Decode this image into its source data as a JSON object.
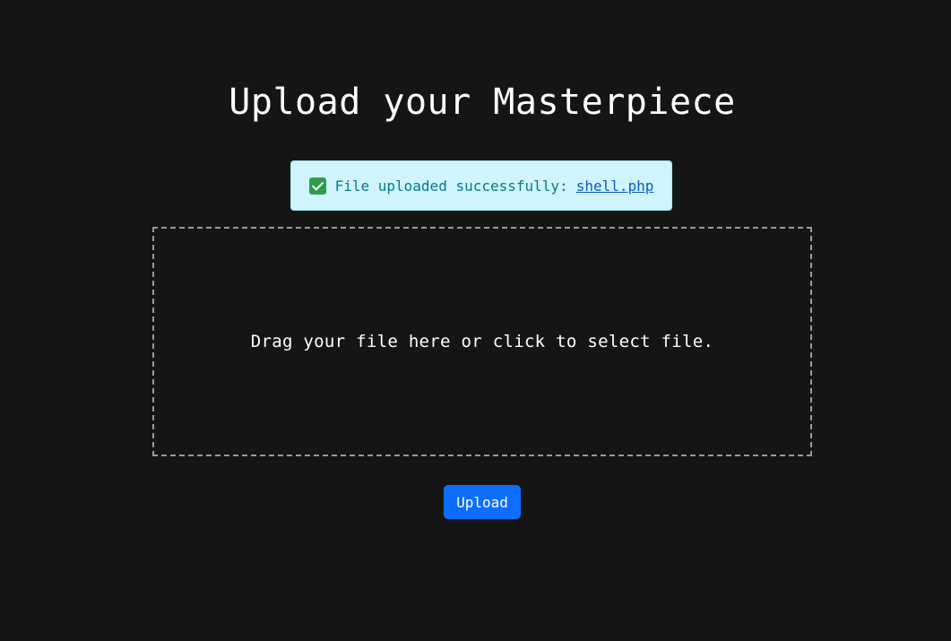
{
  "page": {
    "title": "Upload your Masterpiece"
  },
  "alert": {
    "icon": "check-mark-icon",
    "message": "File uploaded successfully:",
    "filename": "shell.php",
    "colors": {
      "background": "#cff4fc",
      "text": "#087990",
      "link": "#0a58ca"
    }
  },
  "dropzone": {
    "label": "Drag your file here or click to select file."
  },
  "actions": {
    "upload_label": "Upload",
    "color": "#0d6efd"
  }
}
